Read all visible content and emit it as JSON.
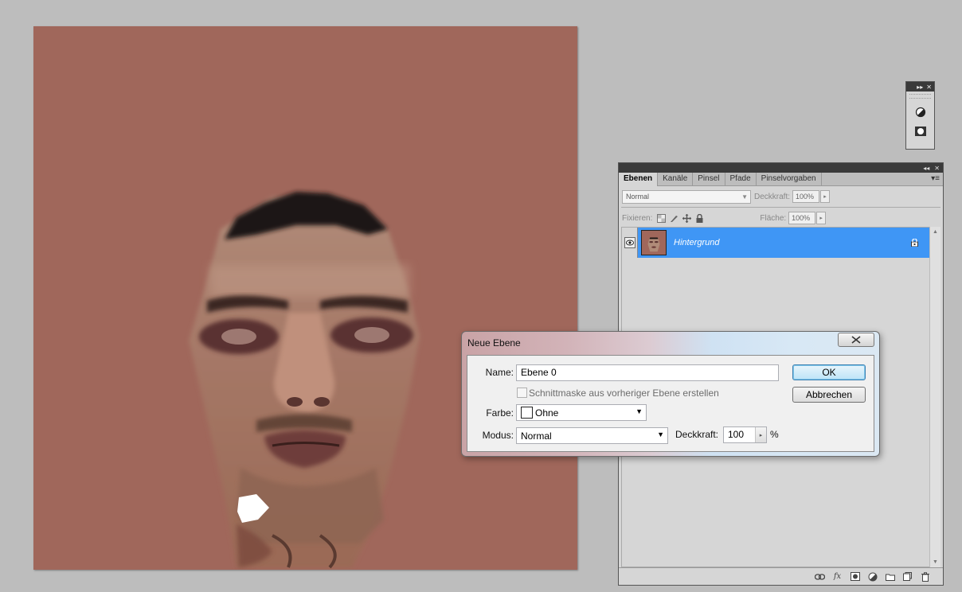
{
  "canvas": {
    "background": "#a0675b"
  },
  "mini_panel": {
    "collapse_glyph": "▸▸",
    "close_glyph": "✕",
    "tools": [
      "adjustment-icon",
      "mask-icon"
    ]
  },
  "layers_panel": {
    "collapse_glyph": "◂◂",
    "close_glyph": "✕",
    "tabs": [
      "Ebenen",
      "Kanäle",
      "Pinsel",
      "Pfade",
      "Pinselvorgaben"
    ],
    "menu_glyph": "▾≡",
    "blend_mode": "Normal",
    "opacity_label": "Deckkraft:",
    "opacity_value": "100%",
    "lock_label": "Fixieren:",
    "fill_label": "Fläche:",
    "fill_value": "100%",
    "layers": [
      {
        "name": "Hintergrund",
        "visible": true,
        "locked": true,
        "selected": true
      }
    ],
    "footer_icons": [
      "link-icon",
      "fx-icon",
      "mask-icon",
      "adjustment-icon",
      "folder-icon",
      "new-layer-icon",
      "trash-icon"
    ],
    "fx_label": "fx"
  },
  "dialog": {
    "title": "Neue Ebene",
    "name_label": "Name:",
    "name_value": "Ebene 0",
    "clip_label": "Schnittmaske aus vorheriger Ebene erstellen",
    "color_label": "Farbe:",
    "color_value": "Ohne",
    "mode_label": "Modus:",
    "mode_value": "Normal",
    "opacity_label": "Deckkraft:",
    "opacity_value": "100",
    "percent": "%",
    "ok": "OK",
    "cancel": "Abbrechen"
  },
  "colors": {
    "selection": "#3f96f5",
    "panel": "#d6d6d6",
    "workspace": "#bdbdbd"
  }
}
